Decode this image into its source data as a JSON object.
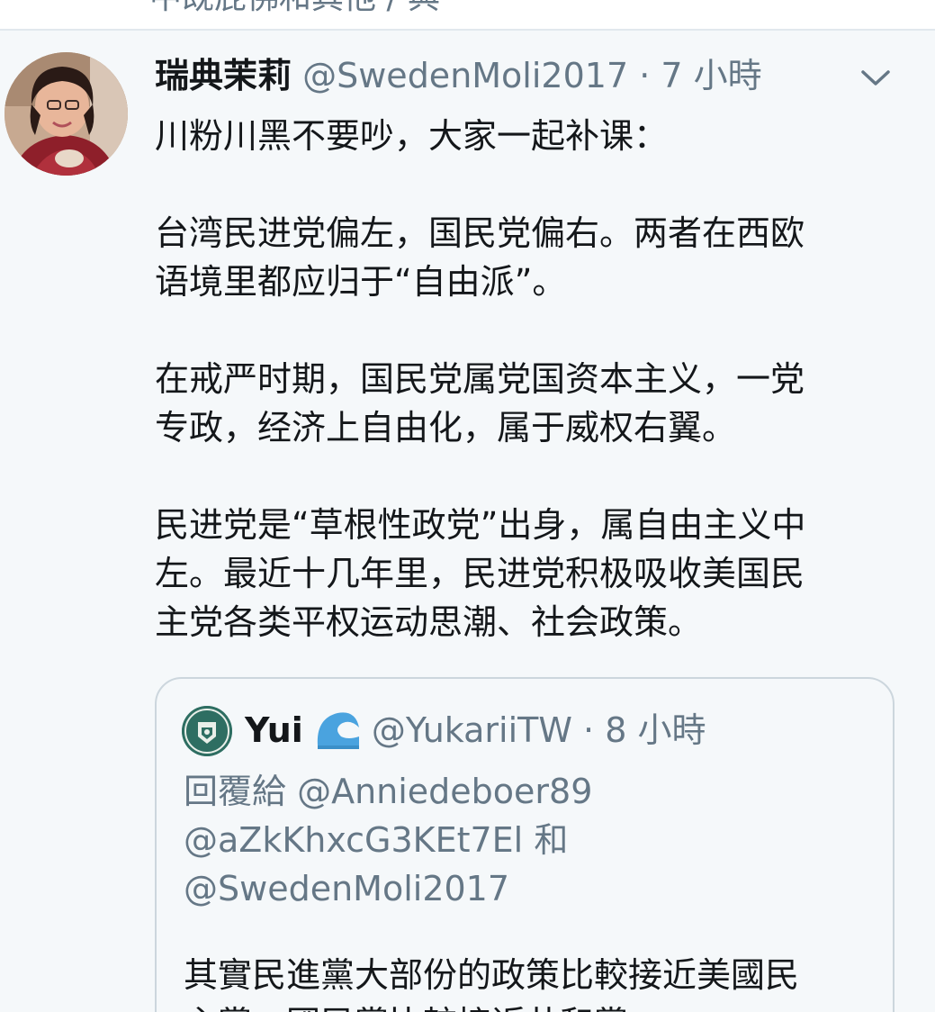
{
  "previous_tweet": {
    "partial_text": "中既屁佛和其他 / 與"
  },
  "tweet": {
    "display_name": "瑞典茉莉",
    "handle": "@SwedenMoli2017",
    "separator": "·",
    "time": "7 小時",
    "menu_icon": "chevron-down-icon",
    "lines": [
      "川粉川黑不要吵，大家一起补课：",
      "",
      "台湾民进党偏左，国民党偏右。两者在西欧",
      "语境里都应归于“自由派”。",
      "",
      "在戒严时期，国民党属党国资本主义，一党",
      "专政，经济上自由化，属于威权右翼。",
      "",
      "民进党是“草根性政党”出身，属自由主义中",
      "左。最近十几年里，民进党积极吸收美国民",
      "主党各类平权运动思潮、社会政策。"
    ]
  },
  "quoted_tweet": {
    "display_name": "Yui",
    "badge_icon": "wave-icon",
    "handle": "@YukariiTW",
    "separator": "·",
    "time": "8 小時",
    "reply_lines": [
      "回覆給 @Anniedeboer89",
      "@aZkKhxcG3KEt7El 和",
      "@SwedenMoli2017"
    ],
    "text_lines": [
      "其實民進黨大部份的政策比較接近美國民",
      "主黨。國民黨比較接近共和黨。"
    ]
  },
  "colors": {
    "background": "#f5f8fa",
    "text_primary": "#14171a",
    "text_secondary": "#657786",
    "border": "#ccd6dd",
    "wave_blue": "#4aa3df"
  }
}
